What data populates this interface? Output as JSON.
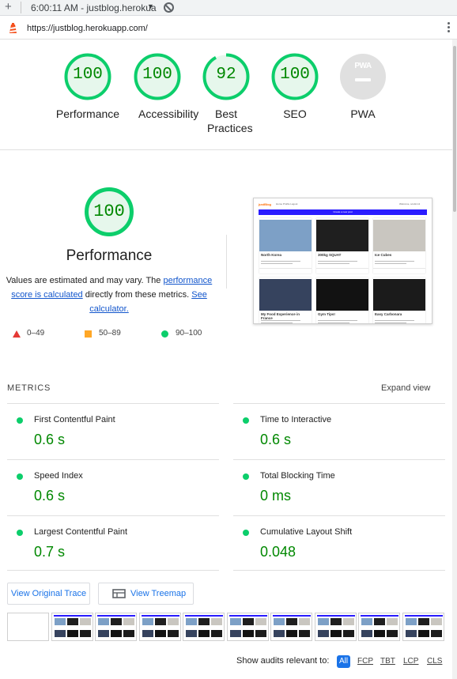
{
  "browser": {
    "time_title": "6:00:11 AM - justblog.herokua",
    "url": "https://justblog.herokuapp.com/",
    "icons": {
      "new_tab": "plus-icon",
      "dropdown": "caret-down-icon",
      "block": "block-icon",
      "lighthouse": "lighthouse-icon",
      "menu": "kebab-menu-icon"
    }
  },
  "categories": [
    {
      "score": "100",
      "label": "Performance",
      "value": 100
    },
    {
      "score": "100",
      "label": "Accessibility",
      "value": 100
    },
    {
      "score": "92",
      "label": "Best Practices",
      "value": 92
    },
    {
      "score": "100",
      "label": "SEO",
      "value": 100
    }
  ],
  "pwa": {
    "badge": "PWA",
    "label": "PWA"
  },
  "performance": {
    "score": "100",
    "title": "Performance",
    "desc_before": "Values are estimated and may vary. The ",
    "link1": "performance score is calculated",
    "desc_middle": " directly from these metrics. ",
    "link2": "See calculator.",
    "legend": [
      {
        "range": "0–49",
        "shape": "triangle",
        "color": "#e53935"
      },
      {
        "range": "50–89",
        "shape": "square",
        "color": "#ffa726"
      },
      {
        "range": "90–100",
        "shape": "circle",
        "color": "#0cce6b"
      }
    ]
  },
  "screenshot": {
    "logo": "justBlog",
    "nav": [
      "Home",
      "Profile",
      "Logout"
    ],
    "user": "Welcome, scottmn1",
    "banner": "Create a new post",
    "cards": [
      {
        "title": "North Korea",
        "img": "#7da0c6"
      },
      {
        "title": "300kg SQUAT",
        "img": "#1f1f1f"
      },
      {
        "title": "Ice Cubes",
        "img": "#c9c6c0"
      },
      {
        "title": "My Food Experience in France",
        "img": "#36435e"
      },
      {
        "title": "Gym Tips!",
        "img": "#121212"
      },
      {
        "title": "Easy Carbonara",
        "img": "#1b1b1b"
      }
    ]
  },
  "metrics": {
    "heading": "METRICS",
    "expand": "Expand view",
    "items": [
      {
        "name": "First Contentful Paint",
        "value": "0.6 s"
      },
      {
        "name": "Time to Interactive",
        "value": "0.6 s"
      },
      {
        "name": "Speed Index",
        "value": "0.6 s"
      },
      {
        "name": "Total Blocking Time",
        "value": "0 ms"
      },
      {
        "name": "Largest Contentful Paint",
        "value": "0.7 s"
      },
      {
        "name": "Cumulative Layout Shift",
        "value": "0.048"
      }
    ]
  },
  "buttons": {
    "trace": "View Original Trace",
    "treemap": "View Treemap",
    "treemap_icon": "treemap-icon"
  },
  "audits": {
    "label": "Show audits relevant to:",
    "filters": [
      "All",
      "FCP",
      "TBT",
      "LCP",
      "CLS"
    ],
    "active": "All"
  }
}
